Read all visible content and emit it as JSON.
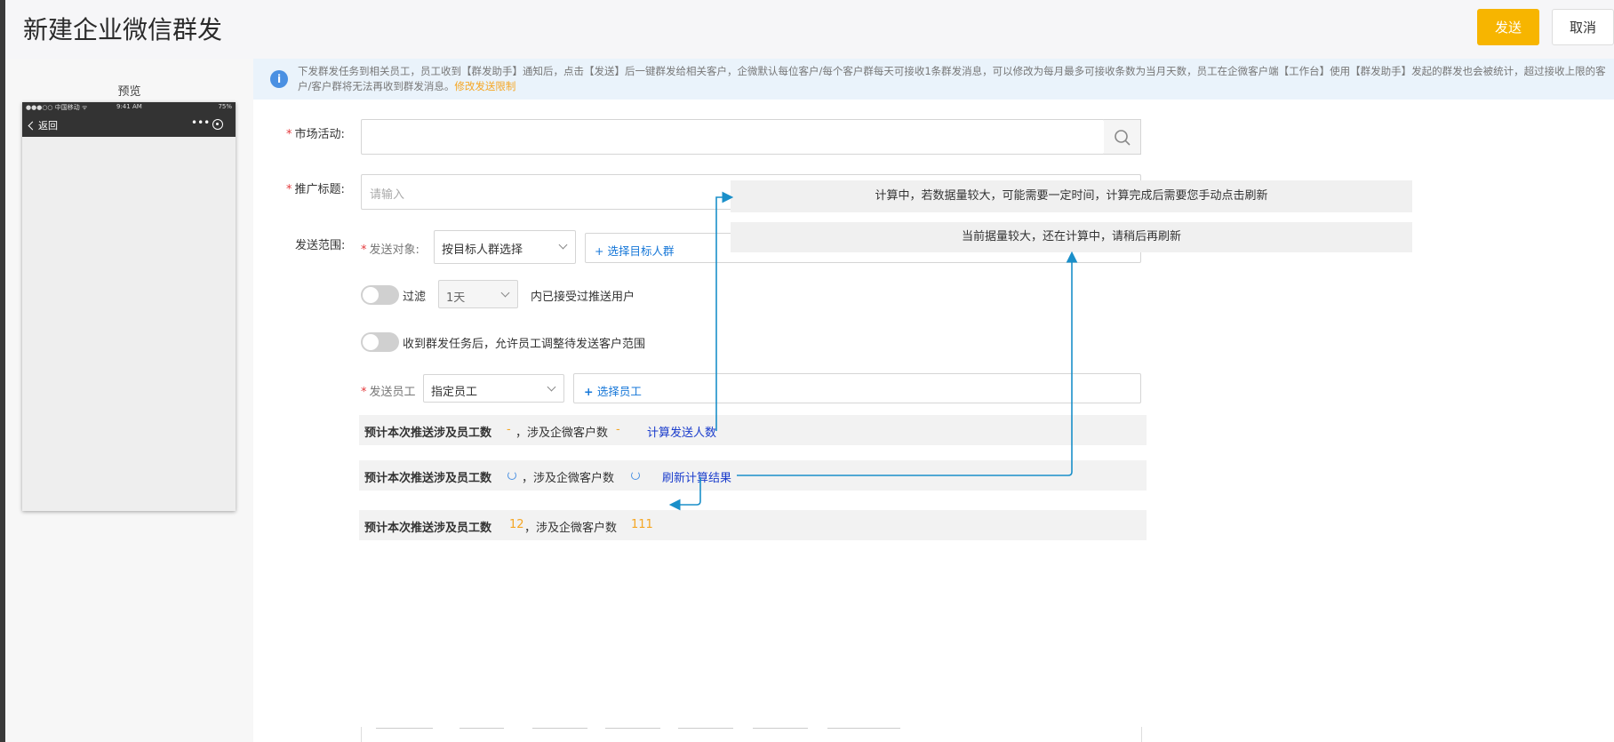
{
  "header": {
    "title": "新建企业微信群发",
    "send_label": "发送",
    "cancel_label": "取消"
  },
  "preview": {
    "label": "预览",
    "status_left": "●●●○○ 中国移动 ᯤ",
    "status_time": "9:41 AM",
    "status_right": "75%",
    "back_label": "返回",
    "more_icon": "•••"
  },
  "notice": {
    "text": "下发群发任务到相关员工，员工收到【群发助手】通知后，点击【发送】后一键群发给相关客户，企微默认每位客户/每个客户群每天可接收1条群发消息，可以修改为每月最多可接收条数为当月天数，员工在企微客户端【工作台】使用【群发助手】发起的群发也会被统计，超过接收上限的客户/客户群将无法再收到群发消息。",
    "link": "修改发送限制"
  },
  "form": {
    "activity_label": "市场活动:",
    "title_label": "推广标题:",
    "title_placeholder": "请输入",
    "scope_label": "发送范围:",
    "target_label": "发送对象:",
    "target_value": "按目标人群选择",
    "target_add": "+ 选择目标人群",
    "filter_label": "过滤",
    "filter_days": "1天",
    "filter_suffix": "内已接受过推送用户",
    "allow_label": "收到群发任务后，允许员工调整待发送客户范围",
    "staff_label": "发送员工",
    "staff_value": "指定员工",
    "staff_add": "选择员工"
  },
  "estimates": {
    "prefix": "预计本次推送涉及员工数",
    "customer_label": "，涉及企微客户数",
    "row1_staff": "-",
    "row1_customer": "-",
    "row1_link": "计算发送人数",
    "row2_link": "刷新计算结果",
    "row3_staff": "12",
    "row3_customer": "111"
  },
  "tips": {
    "computing": "计算中，若数据量较大，可能需要一定时间，计算完成后需要您手动点击刷新",
    "still_computing": "当前据量较大，还在计算中，请稍后再刷新"
  },
  "colors": {
    "primary_button": "#f7b500",
    "link_blue": "#1677d8",
    "highlight_orange": "#f5a623",
    "arrow": "#1a8fc9"
  }
}
